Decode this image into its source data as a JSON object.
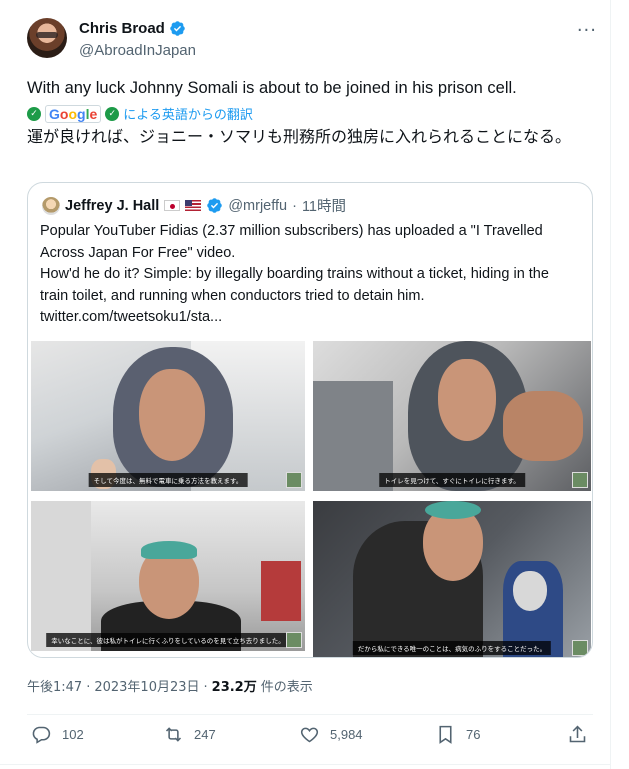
{
  "author": {
    "display_name": "Chris Broad",
    "handle": "@AbroadInJapan"
  },
  "tweet": {
    "text": "With any luck Johnny Somali is about to be joined in his prison cell.",
    "translate_by": "Google",
    "translate_label": "による英語からの翻訳",
    "translated_text": "運が良ければ、ジョニー・ソマリも刑務所の独房に入れられることになる。"
  },
  "quote": {
    "author_name": "Jeffrey J. Hall",
    "handle": "@mrjeffu",
    "separator": "·",
    "time": "11時間",
    "lines": [
      "Popular YouTuber Fidias (2.37 million subscribers) has uploaded a \"I Travelled",
      "Across Japan For Free\" video.",
      "How'd he do it?  Simple: by illegally boarding trains without a ticket, hiding in the",
      "train toilet, and running when conductors tried to detain him.",
      "twitter.com/tweetsoku1/sta..."
    ],
    "media": [
      {
        "subtitle": "そして今度は、無料で電車に乗る方法を教えます。"
      },
      {
        "subtitle": "トイレを見つけて、すぐにトイレに行きます。"
      },
      {
        "subtitle": "幸いなことに、彼は私がトイレに行くふりをしているのを見て立ち去りました。"
      },
      {
        "subtitle": "だから私にできる唯一のことは、病気のふりをすることだった。"
      }
    ]
  },
  "meta": {
    "time": "午後1:47",
    "sep1": "·",
    "date": "2023年10月23日",
    "sep2": "·",
    "views_count": "23.2万",
    "views_label": "件の表示"
  },
  "actions": {
    "replies": "102",
    "reposts": "247",
    "likes": "5,984",
    "bookmarks": "76"
  },
  "colors": {
    "accent": "#1d9bf0",
    "text": "#0f1419",
    "secondary": "#536471"
  }
}
